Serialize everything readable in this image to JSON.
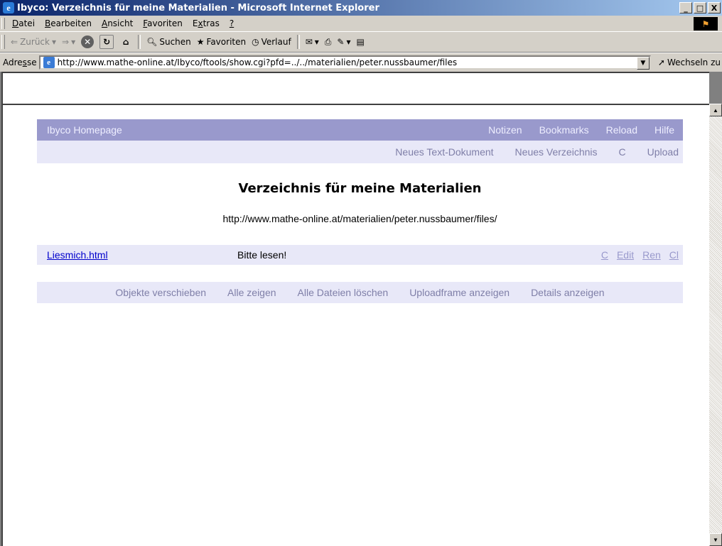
{
  "window": {
    "title": "Ibyco: Verzeichnis für meine Materialien - Microsoft Internet Explorer",
    "icon": "ie-icon",
    "controls": [
      "_",
      "□",
      "X"
    ]
  },
  "menubar": {
    "items": [
      {
        "first": "D",
        "rest": "atei"
      },
      {
        "first": "B",
        "rest": "earbeiten"
      },
      {
        "first": "A",
        "rest": "nsicht"
      },
      {
        "first": "F",
        "rest": "avoriten"
      },
      {
        "pre": "E",
        "first": "x",
        "rest": "tras"
      },
      {
        "first": "?",
        "rest": ""
      }
    ]
  },
  "toolbar": {
    "back": "Zurück",
    "search": "Suchen",
    "favorites": "Favoriten",
    "history": "Verlauf"
  },
  "addressbar": {
    "label_pre": "Adre",
    "label_u": "s",
    "label_post": "se",
    "url": "http://www.mathe-online.at/Ibyco/ftools/show.cgi?pfd=../../materialien/peter.nussbaumer/files",
    "go": "Wechseln zu"
  },
  "nav": {
    "home": "Ibyco Homepage",
    "links": [
      "Notizen",
      "Bookmarks",
      "Reload",
      "Hilfe"
    ],
    "actions": [
      "Neues Text-Dokument",
      "Neues Verzeichnis",
      "C",
      "Upload"
    ]
  },
  "page": {
    "heading": "Verzeichnis für meine Materialien",
    "url": "http://www.mathe-online.at/materialien/peter.nussbaumer/files/"
  },
  "files": [
    {
      "name": "Liesmich.html",
      "desc": "Bitte lesen!",
      "actions": [
        "C",
        "Edit",
        "Ren",
        "Cl"
      ]
    }
  ],
  "bottom": [
    "Objekte verschieben",
    "Alle zeigen",
    "Alle Dateien löschen",
    "Uploadframe anzeigen",
    "Details anzeigen"
  ]
}
